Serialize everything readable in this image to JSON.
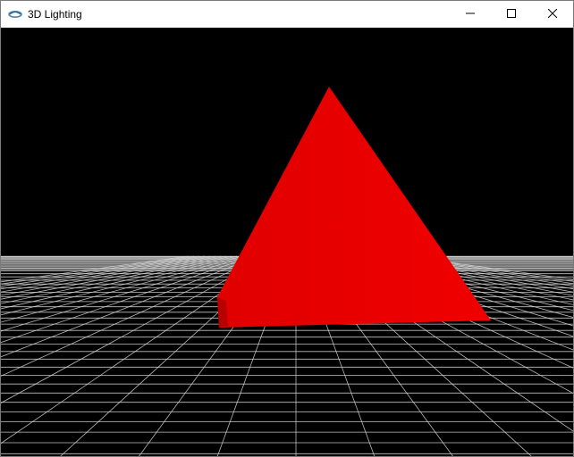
{
  "window": {
    "title": "3D Lighting",
    "app_icon": "app-logo-icon",
    "controls": {
      "minimize_icon": "minimize-icon",
      "maximize_icon": "maximize-icon",
      "close_icon": "close-icon"
    }
  },
  "scene": {
    "background_color": "#000000",
    "floor_grid_color": "#d8d8d8",
    "pyramid_color": "#e00000",
    "pyramid_highlight": "#f00000",
    "pyramid_shade": "#b80000"
  }
}
